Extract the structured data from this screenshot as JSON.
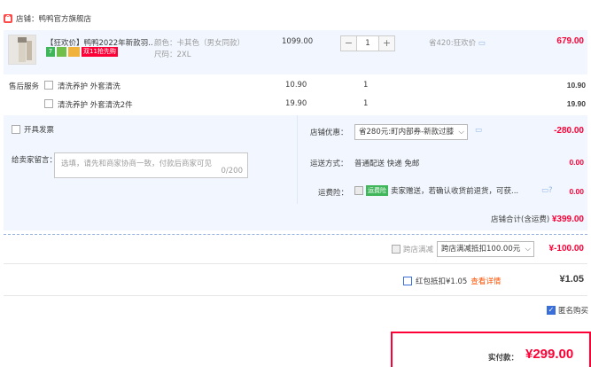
{
  "shop": {
    "icon": "shop-icon",
    "label": "店铺：",
    "name": "鸭鸭官方旗舰店"
  },
  "item": {
    "title": "【狂欢价】鸭鸭2022年新款羽...",
    "color_label": "颜色：卡其色（男女同款）",
    "size_label": "尺码：2XL",
    "badge_7": "7",
    "badge_double11": "双11抢先购",
    "unit_price": "1099.00",
    "quantity": "1",
    "discount_note": "省420:狂欢价",
    "subtotal": "679.00"
  },
  "services": {
    "header": "售后服务",
    "rows": [
      {
        "label": "清洗养护 外套清洗",
        "price": "10.90",
        "qty": "1",
        "total": "10.90"
      },
      {
        "label": "清洗养护 外套清洗2件",
        "price": "19.90",
        "qty": "1",
        "total": "19.90"
      }
    ]
  },
  "invoice": {
    "label": "开具发票"
  },
  "message": {
    "label": "给卖家留言：",
    "placeholder": "选填，请先和商家协商一致，付款后商家可见",
    "counter": "0/200"
  },
  "shop_coupon": {
    "label": "店铺优惠：",
    "select_value": "省280元:町内部券-新款过膝",
    "amount": "-280.00"
  },
  "shipping": {
    "label": "运送方式：",
    "value": "普通配送 快递 免邮",
    "amount": "0.00"
  },
  "insurance": {
    "label": "运费险：",
    "tag": "运费险",
    "text": "卖家赠送，若确认收货前退货，可获...",
    "amount": "0.00"
  },
  "shop_total": {
    "label": "店铺合计(含运费)",
    "amount": "¥399.00"
  },
  "cross_store": {
    "label": "跨店满减",
    "select_value": "跨店满减抵扣100.00元",
    "amount": "¥-100.00"
  },
  "red_packet": {
    "label": "红包抵扣¥1.05",
    "link": "查看详情",
    "amount": "¥1.05"
  },
  "anonymous": {
    "label_fragment": "匿名购买"
  },
  "footer": {
    "label": "实付款：",
    "amount": "¥299.00"
  },
  "colors": {
    "accent": "#ff0036",
    "panel_bg": "#f2f7ff",
    "badge_green": "#3fb65a",
    "badge_red": "#ff0036"
  }
}
